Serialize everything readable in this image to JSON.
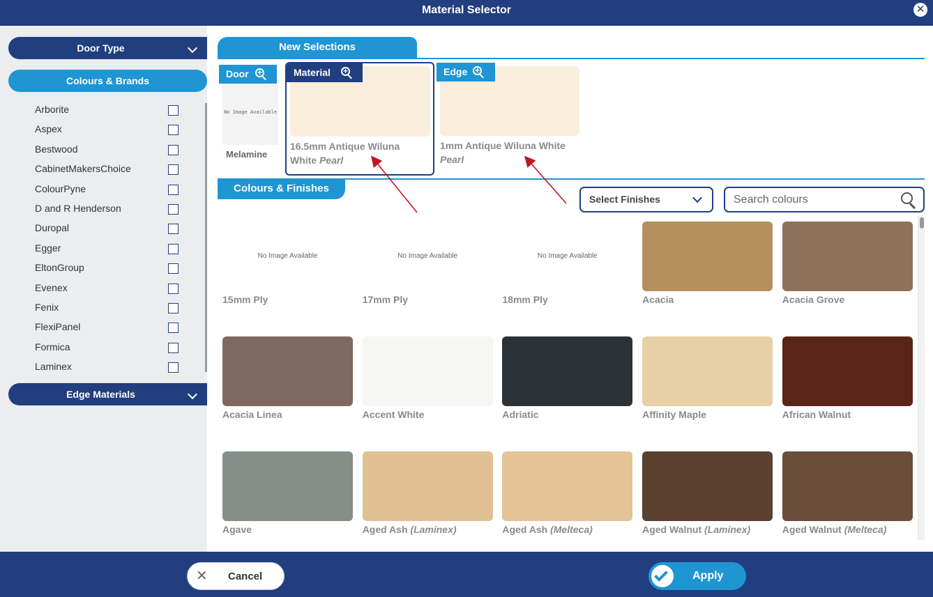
{
  "window": {
    "title": "Material Selector"
  },
  "sidebar": {
    "door_type": "Door Type",
    "colours_brands": "Colours & Brands",
    "edge_materials": "Edge Materials",
    "brands": [
      "Arborite",
      "Aspex",
      "Bestwood",
      "CabinetMakersChoice",
      "ColourPyne",
      "D and R Henderson",
      "Duropal",
      "Egger",
      "EltonGroup",
      "Evenex",
      "Fenix",
      "FlexiPanel",
      "Formica",
      "Laminex"
    ]
  },
  "new_selections": {
    "tab": "New Selections",
    "door": {
      "tag": "Door",
      "no_image": "No Image Available",
      "name": "Melamine"
    },
    "material": {
      "tag": "Material",
      "name": "16.5mm Antique Wiluna White",
      "finish": "Pearl",
      "color": "#f8eedb"
    },
    "edge": {
      "tag": "Edge",
      "name": "1mm Antique Wiluna White",
      "finish": "Pearl",
      "color": "#f8eedb"
    }
  },
  "colours_finishes": {
    "tab": "Colours & Finishes",
    "select_finishes": "Select Finishes",
    "search_placeholder": "Search colours",
    "no_image": "No Image Available",
    "items": [
      {
        "name": "15mm Ply",
        "finish": "",
        "color": ""
      },
      {
        "name": "17mm Ply",
        "finish": "",
        "color": ""
      },
      {
        "name": "18mm Ply",
        "finish": "",
        "color": ""
      },
      {
        "name": "Acacia",
        "finish": "",
        "color": "#b58f5e"
      },
      {
        "name": "Acacia Grove",
        "finish": "",
        "color": "#8e7158"
      },
      {
        "name": "Acacia Linea",
        "finish": "",
        "color": "#7f685f"
      },
      {
        "name": "Accent White",
        "finish": "",
        "color": "#f6f6f4"
      },
      {
        "name": "Adriatic",
        "finish": "",
        "color": "#2a3238"
      },
      {
        "name": "Affinity Maple",
        "finish": "",
        "color": "#e7cfa6"
      },
      {
        "name": "African Walnut",
        "finish": "",
        "color": "#5a2418"
      },
      {
        "name": "Agave",
        "finish": "",
        "color": "#858e89"
      },
      {
        "name": "Aged Ash",
        "finish": "(Laminex)",
        "color": "#e1c194"
      },
      {
        "name": "Aged Ash",
        "finish": "(Melteca)",
        "color": "#e2c497"
      },
      {
        "name": "Aged Walnut",
        "finish": "(Laminex)",
        "color": "#5b4130"
      },
      {
        "name": "Aged Walnut",
        "finish": "(Melteca)",
        "color": "#6b4d3b"
      }
    ]
  },
  "footer": {
    "cancel": "Cancel",
    "apply": "Apply"
  },
  "colors": {
    "navy": "#213e7f",
    "accent": "#1f95d4"
  }
}
